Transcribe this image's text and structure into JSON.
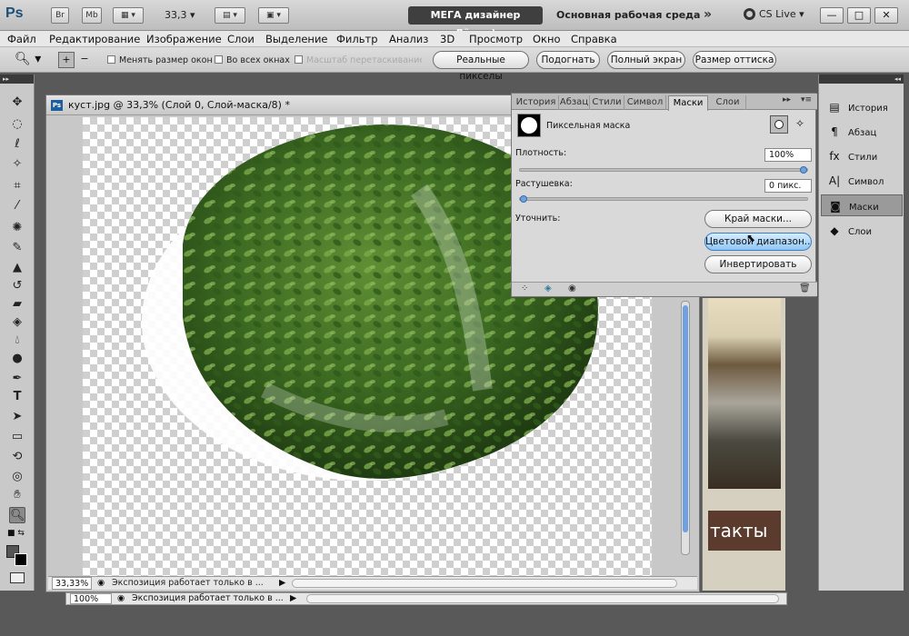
{
  "appbar": {
    "logo": "Ps",
    "bridge_label": "Br",
    "minibridge_label": "Mb",
    "zoom": "33,3",
    "user_chip": "МЕГА дизайнер Лёха=)",
    "workspace": "Основная рабочая среда",
    "overflow": "»",
    "cs_live": "CS Live ▾",
    "minimize": "—",
    "maximize": "□",
    "close": "✕"
  },
  "menu": {
    "items": [
      "Файл",
      "Редактирование",
      "Изображение",
      "Слои",
      "Выделение",
      "Фильтр",
      "Анализ",
      "3D",
      "Просмотр",
      "Окно",
      "Справка"
    ]
  },
  "options": {
    "resize_windows": "Менять размер окон",
    "all_windows": "Во всех окнах",
    "scrubby_zoom": "Масштаб перетаскиванием",
    "actual_pixels": "Реальные пикселы",
    "fit": "Подогнать",
    "fill_screen": "Полный экран",
    "print_size": "Размер оттиска"
  },
  "document": {
    "title": "куст.jpg @ 33,3% (Слой 0, Слой-маска/8) *",
    "zoom": "33,33%",
    "status": "Экспозиция работает только в ..."
  },
  "document2": {
    "zoom": "100%",
    "status": "Экспозиция работает только в ..."
  },
  "background_doc": {
    "text": "такты"
  },
  "panel": {
    "tabs": [
      "История",
      "Абзац",
      "Стили",
      "Символ",
      "Маски",
      "Слои"
    ],
    "active_tab": "Маски",
    "mask_type": "Пиксельная маска",
    "density_label": "Плотность:",
    "density_value": "100%",
    "density": 1.0,
    "feather_label": "Растушевка:",
    "feather_value": "0 пикс.",
    "feather": 0.0,
    "refine_label": "Уточнить:",
    "mask_edge": "Край маски...",
    "color_range": "Цветовой диапазон...",
    "invert": "Инвертировать"
  },
  "dock": {
    "items": [
      "История",
      "Абзац",
      "Стили",
      "Символ",
      "Маски",
      "Слои"
    ],
    "active": "Маски"
  }
}
